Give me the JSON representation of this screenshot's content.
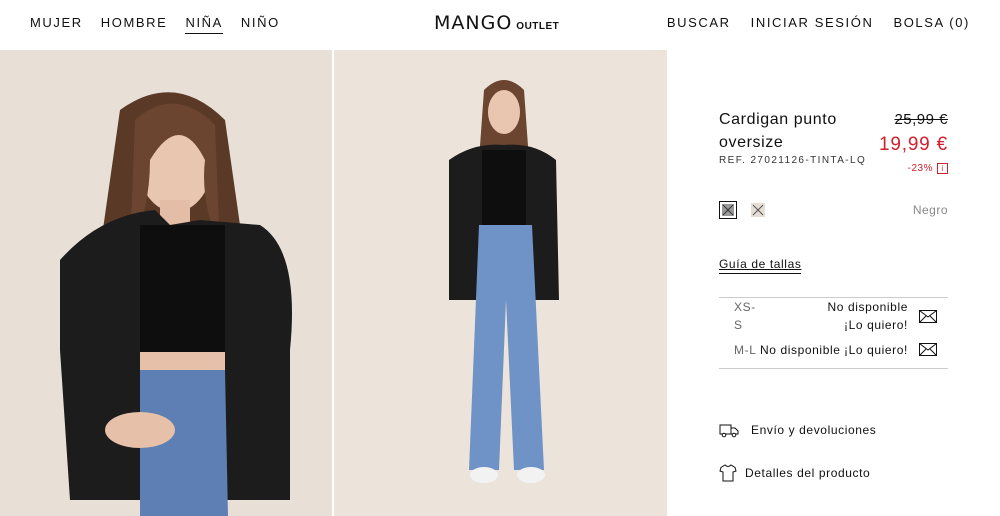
{
  "header": {
    "nav_left": [
      "MUJER",
      "HOMBRE",
      "NIÑA",
      "NIÑO"
    ],
    "active_nav": "NIÑA",
    "logo_brand": "MANGO",
    "logo_sub": "OUTLET",
    "nav_right": [
      "BUSCAR",
      "INICIAR SESIÓN",
      "BOLSA (0)"
    ]
  },
  "product": {
    "title": "Cardigan punto oversize",
    "ref": "REF. 27021126-TINTA-LQ",
    "old_price": "25,99 €",
    "new_price": "19,99 €",
    "discount": "-23%",
    "discount_info_icon": "i",
    "color_name": "Negro",
    "swatches": [
      {
        "name": "swatch-selected",
        "color": "#9a9a9a"
      },
      {
        "name": "swatch-alt",
        "color": "#e6ddd5"
      }
    ],
    "size_guide": "Guía de tallas",
    "sizes": [
      {
        "label": "XS-S",
        "status": "No disponible",
        "action": "¡Lo quiero!",
        "icon": "mail-icon"
      },
      {
        "label": "M-L",
        "status": "No disponible",
        "action": "¡Lo quiero!",
        "icon": "mail-icon"
      }
    ],
    "shipping_label": "Envío y devoluciones",
    "details_label": "Detalles del producto"
  },
  "colors": {
    "sale_red": "#d0212c",
    "text": "#111111",
    "muted": "#888888"
  }
}
